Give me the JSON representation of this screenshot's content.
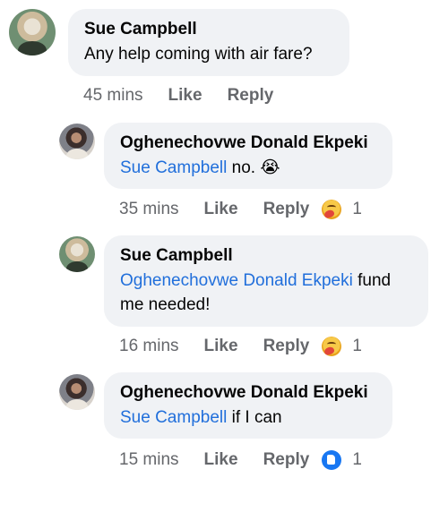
{
  "comments": [
    {
      "author": "Sue Campbell",
      "mention": "",
      "text": "Any help coming with air fare?",
      "time": "45 mins",
      "like": "Like",
      "reply": "Reply",
      "reaction": {
        "icon": "",
        "count": ""
      }
    },
    {
      "author": "Oghenechovwe Donald Ekpeki",
      "mention": "Sue Campbell",
      "text": " no. 😭",
      "time": "35 mins",
      "like": "Like",
      "reply": "Reply",
      "reaction": {
        "icon": "care-reaction-icon",
        "count": "1"
      }
    },
    {
      "author": "Sue Campbell",
      "mention": "Oghenechovwe Donald Ekpeki",
      "text": " fund me needed!",
      "time": "16 mins",
      "like": "Like",
      "reply": "Reply",
      "reaction": {
        "icon": "care-reaction-icon",
        "count": "1"
      }
    },
    {
      "author": "Oghenechovwe Donald Ekpeki",
      "mention": "Sue Campbell",
      "text": " if I can",
      "time": "15 mins",
      "like": "Like",
      "reply": "Reply",
      "reaction": {
        "icon": "like-reaction-icon",
        "count": "1"
      }
    }
  ],
  "colors": {
    "mention": "#216fdb",
    "bubble": "#f0f2f5",
    "meta": "#65676b",
    "like": "#1877f2"
  }
}
